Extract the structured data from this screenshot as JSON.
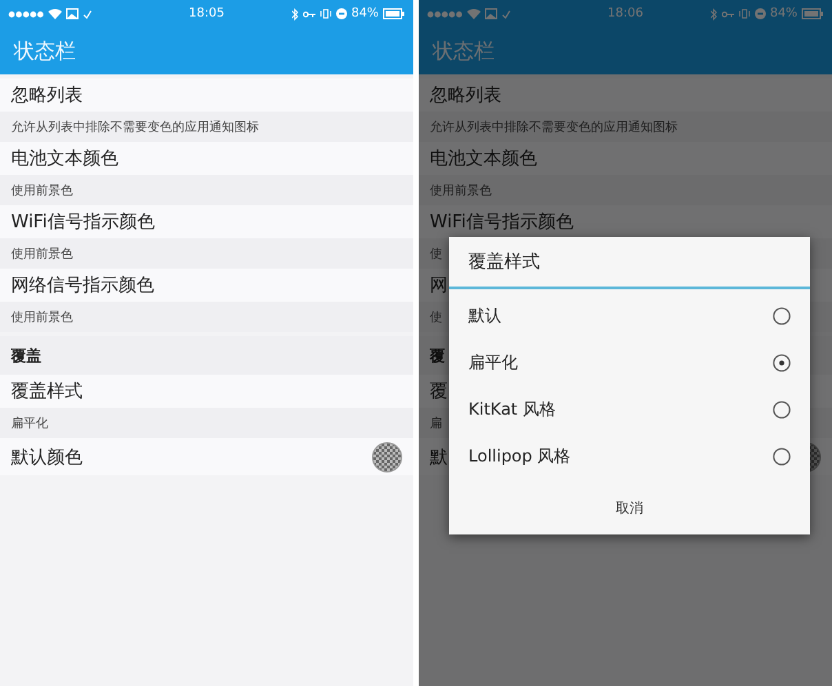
{
  "screens": [
    {
      "status_bar": {
        "time": "18:05",
        "battery": "84%"
      },
      "app_bar": {
        "title": "状态栏"
      },
      "settings": [
        {
          "kind": "item",
          "title": "忽略列表",
          "summary": "允许从列表中排除不需要变色的应用通知图标"
        },
        {
          "kind": "item",
          "title": "电池文本颜色",
          "summary": "使用前景色"
        },
        {
          "kind": "item",
          "title": "WiFi信号指示颜色",
          "summary": "使用前景色"
        },
        {
          "kind": "item",
          "title": "网络信号指示颜色",
          "summary": "使用前景色"
        },
        {
          "kind": "category",
          "title": "覆盖"
        },
        {
          "kind": "item",
          "title": "覆盖样式",
          "summary": "扁平化"
        },
        {
          "kind": "color",
          "title": "默认颜色"
        }
      ]
    },
    {
      "status_bar": {
        "time": "18:06",
        "battery": "84%"
      },
      "app_bar": {
        "title": "状态栏"
      },
      "dimmed": true,
      "settings": [
        {
          "kind": "item",
          "title": "忽略列表",
          "summary": "允许从列表中排除不需要变色的应用通知图标"
        },
        {
          "kind": "item",
          "title": "电池文本颜色",
          "summary": "使用前景色"
        },
        {
          "kind": "item",
          "title": "WiFi信号指示颜色",
          "summary": "使"
        },
        {
          "kind": "item",
          "title": "网",
          "summary": "使"
        },
        {
          "kind": "category",
          "title": "覆"
        },
        {
          "kind": "item",
          "title": "覆",
          "summary": "扁"
        },
        {
          "kind": "color",
          "title": "默"
        }
      ],
      "dialog": {
        "title": "覆盖样式",
        "options": [
          {
            "label": "默认",
            "selected": false
          },
          {
            "label": "扁平化",
            "selected": true
          },
          {
            "label": "KitKat 风格",
            "selected": false
          },
          {
            "label": "Lollipop 风格",
            "selected": false
          }
        ],
        "button": "取消"
      }
    }
  ]
}
